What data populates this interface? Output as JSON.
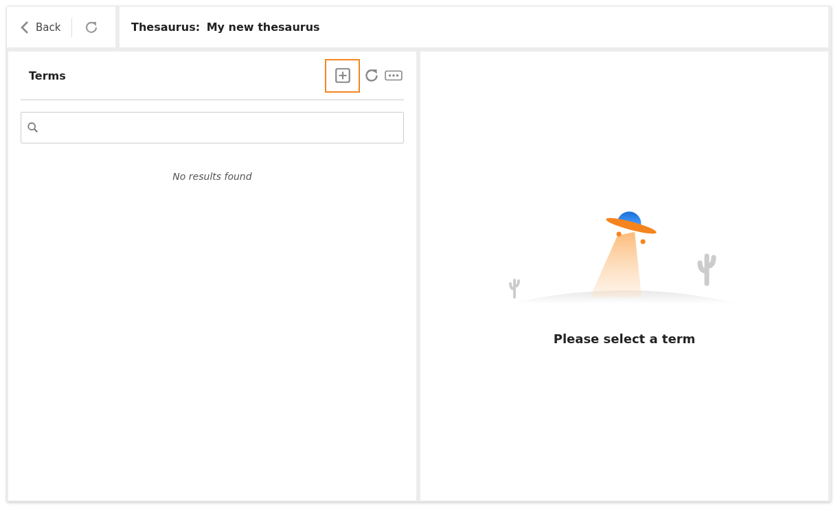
{
  "header": {
    "back_label": "Back",
    "title_label": "Thesaurus:",
    "title_value": "My new thesaurus"
  },
  "terms_panel": {
    "title": "Terms",
    "tools": [
      {
        "kind": "add",
        "highlighted": true
      },
      {
        "kind": "refresh",
        "highlighted": false
      },
      {
        "kind": "more",
        "highlighted": false
      }
    ],
    "empty_message": "No results found"
  },
  "detail_panel": {
    "message": "Please select a term"
  }
}
